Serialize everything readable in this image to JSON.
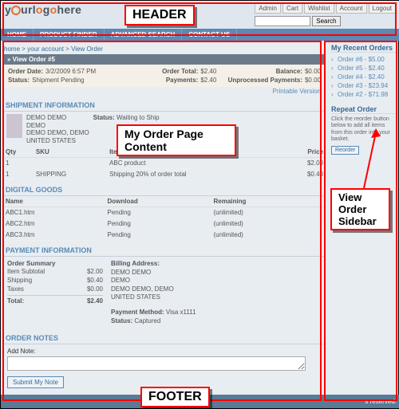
{
  "header": {
    "logo": "yourlogohere",
    "util": [
      "Admin",
      "Cart",
      "Wishlist",
      "Account",
      "Logout"
    ],
    "search_btn": "Search",
    "nav": [
      "HOME",
      "PRODUCT FINDER",
      "ADVANCED SEARCH",
      "CONTACT US"
    ]
  },
  "crumb": [
    "home",
    "your account",
    "View Order"
  ],
  "orderbar": "View Order #5",
  "order": {
    "date_lbl": "Order Date:",
    "date": "3/2/2009 6:57 PM",
    "total_lbl": "Order Total:",
    "total": "$2.40",
    "bal_lbl": "Balance:",
    "bal": "$0.00",
    "stat_lbl": "Status:",
    "stat": "Shipment Pending",
    "pay_lbl": "Payments:",
    "pay": "$2.40",
    "unp_lbl": "Unprocessed Payments:",
    "unp": "$0.00",
    "printable": "Printable Version"
  },
  "ship": {
    "title": "SHIPMENT INFORMATION",
    "addr": [
      "DEMO DEMO",
      "DEMO",
      "DEMO DEMO, DEMO",
      "UNITED STATES"
    ],
    "status_lbl": "Status:",
    "status": "Waiting to Ship",
    "cols": {
      "qty": "Qty",
      "sku": "SKU",
      "item": "Item",
      "price": "Price"
    },
    "rows": [
      {
        "qty": "1",
        "sku": "",
        "item": "ABC product",
        "price": "$2.00"
      },
      {
        "qty": "1",
        "sku": "SHIPPING",
        "item": "Shipping 20% of order total",
        "price": "$0.40"
      }
    ]
  },
  "dg": {
    "title": "DIGITAL GOODS",
    "cols": {
      "name": "Name",
      "dl": "Download",
      "rem": "Remaining"
    },
    "rows": [
      {
        "name": "ABC1.htm",
        "dl": "Pending",
        "rem": "(unlimited)"
      },
      {
        "name": "ABC2.htm",
        "dl": "Pending",
        "rem": "(unlimited)"
      },
      {
        "name": "ABC3.htm",
        "dl": "Pending",
        "rem": "(unlimited)"
      }
    ]
  },
  "payment": {
    "title": "PAYMENT INFORMATION",
    "sum_lbl": "Order Summary",
    "sub_lbl": "Item Subtotal",
    "sub": "$2.00",
    "ship_lbl": "Shipping",
    "ship": "$0.40",
    "tax_lbl": "Taxes",
    "tax": "$0.00",
    "tot_lbl": "Total:",
    "tot": "$2.40",
    "bill_lbl": "Billing Address:",
    "bill": [
      "DEMO DEMO",
      "DEMO",
      "DEMO DEMO, DEMO",
      "UNITED STATES"
    ],
    "pm_lbl": "Payment Method:",
    "pm": "Visa x1111",
    "st_lbl": "Status:",
    "st": "Captured"
  },
  "notes": {
    "title": "ORDER NOTES",
    "add": "Add Note:",
    "btn": "Submit My Note"
  },
  "sidebar": {
    "recent_title": "My Recent Orders",
    "orders": [
      "Order #6 - $5.00",
      "Order #5 - $2.40",
      "Order #4 - $2.40",
      "Order #3 - $23.94",
      "Order #2 - $71.98"
    ],
    "repeat_title": "Repeat Order",
    "repeat_txt": "Click the reorder button below to add all items from this order into your basket.",
    "repeat_btn": "Reorder"
  },
  "footer": "s reserved.",
  "ann": {
    "header": "HEADER",
    "content": "My Order Page Content",
    "sidebar": "View Order Sidebar",
    "footer": "FOOTER"
  }
}
